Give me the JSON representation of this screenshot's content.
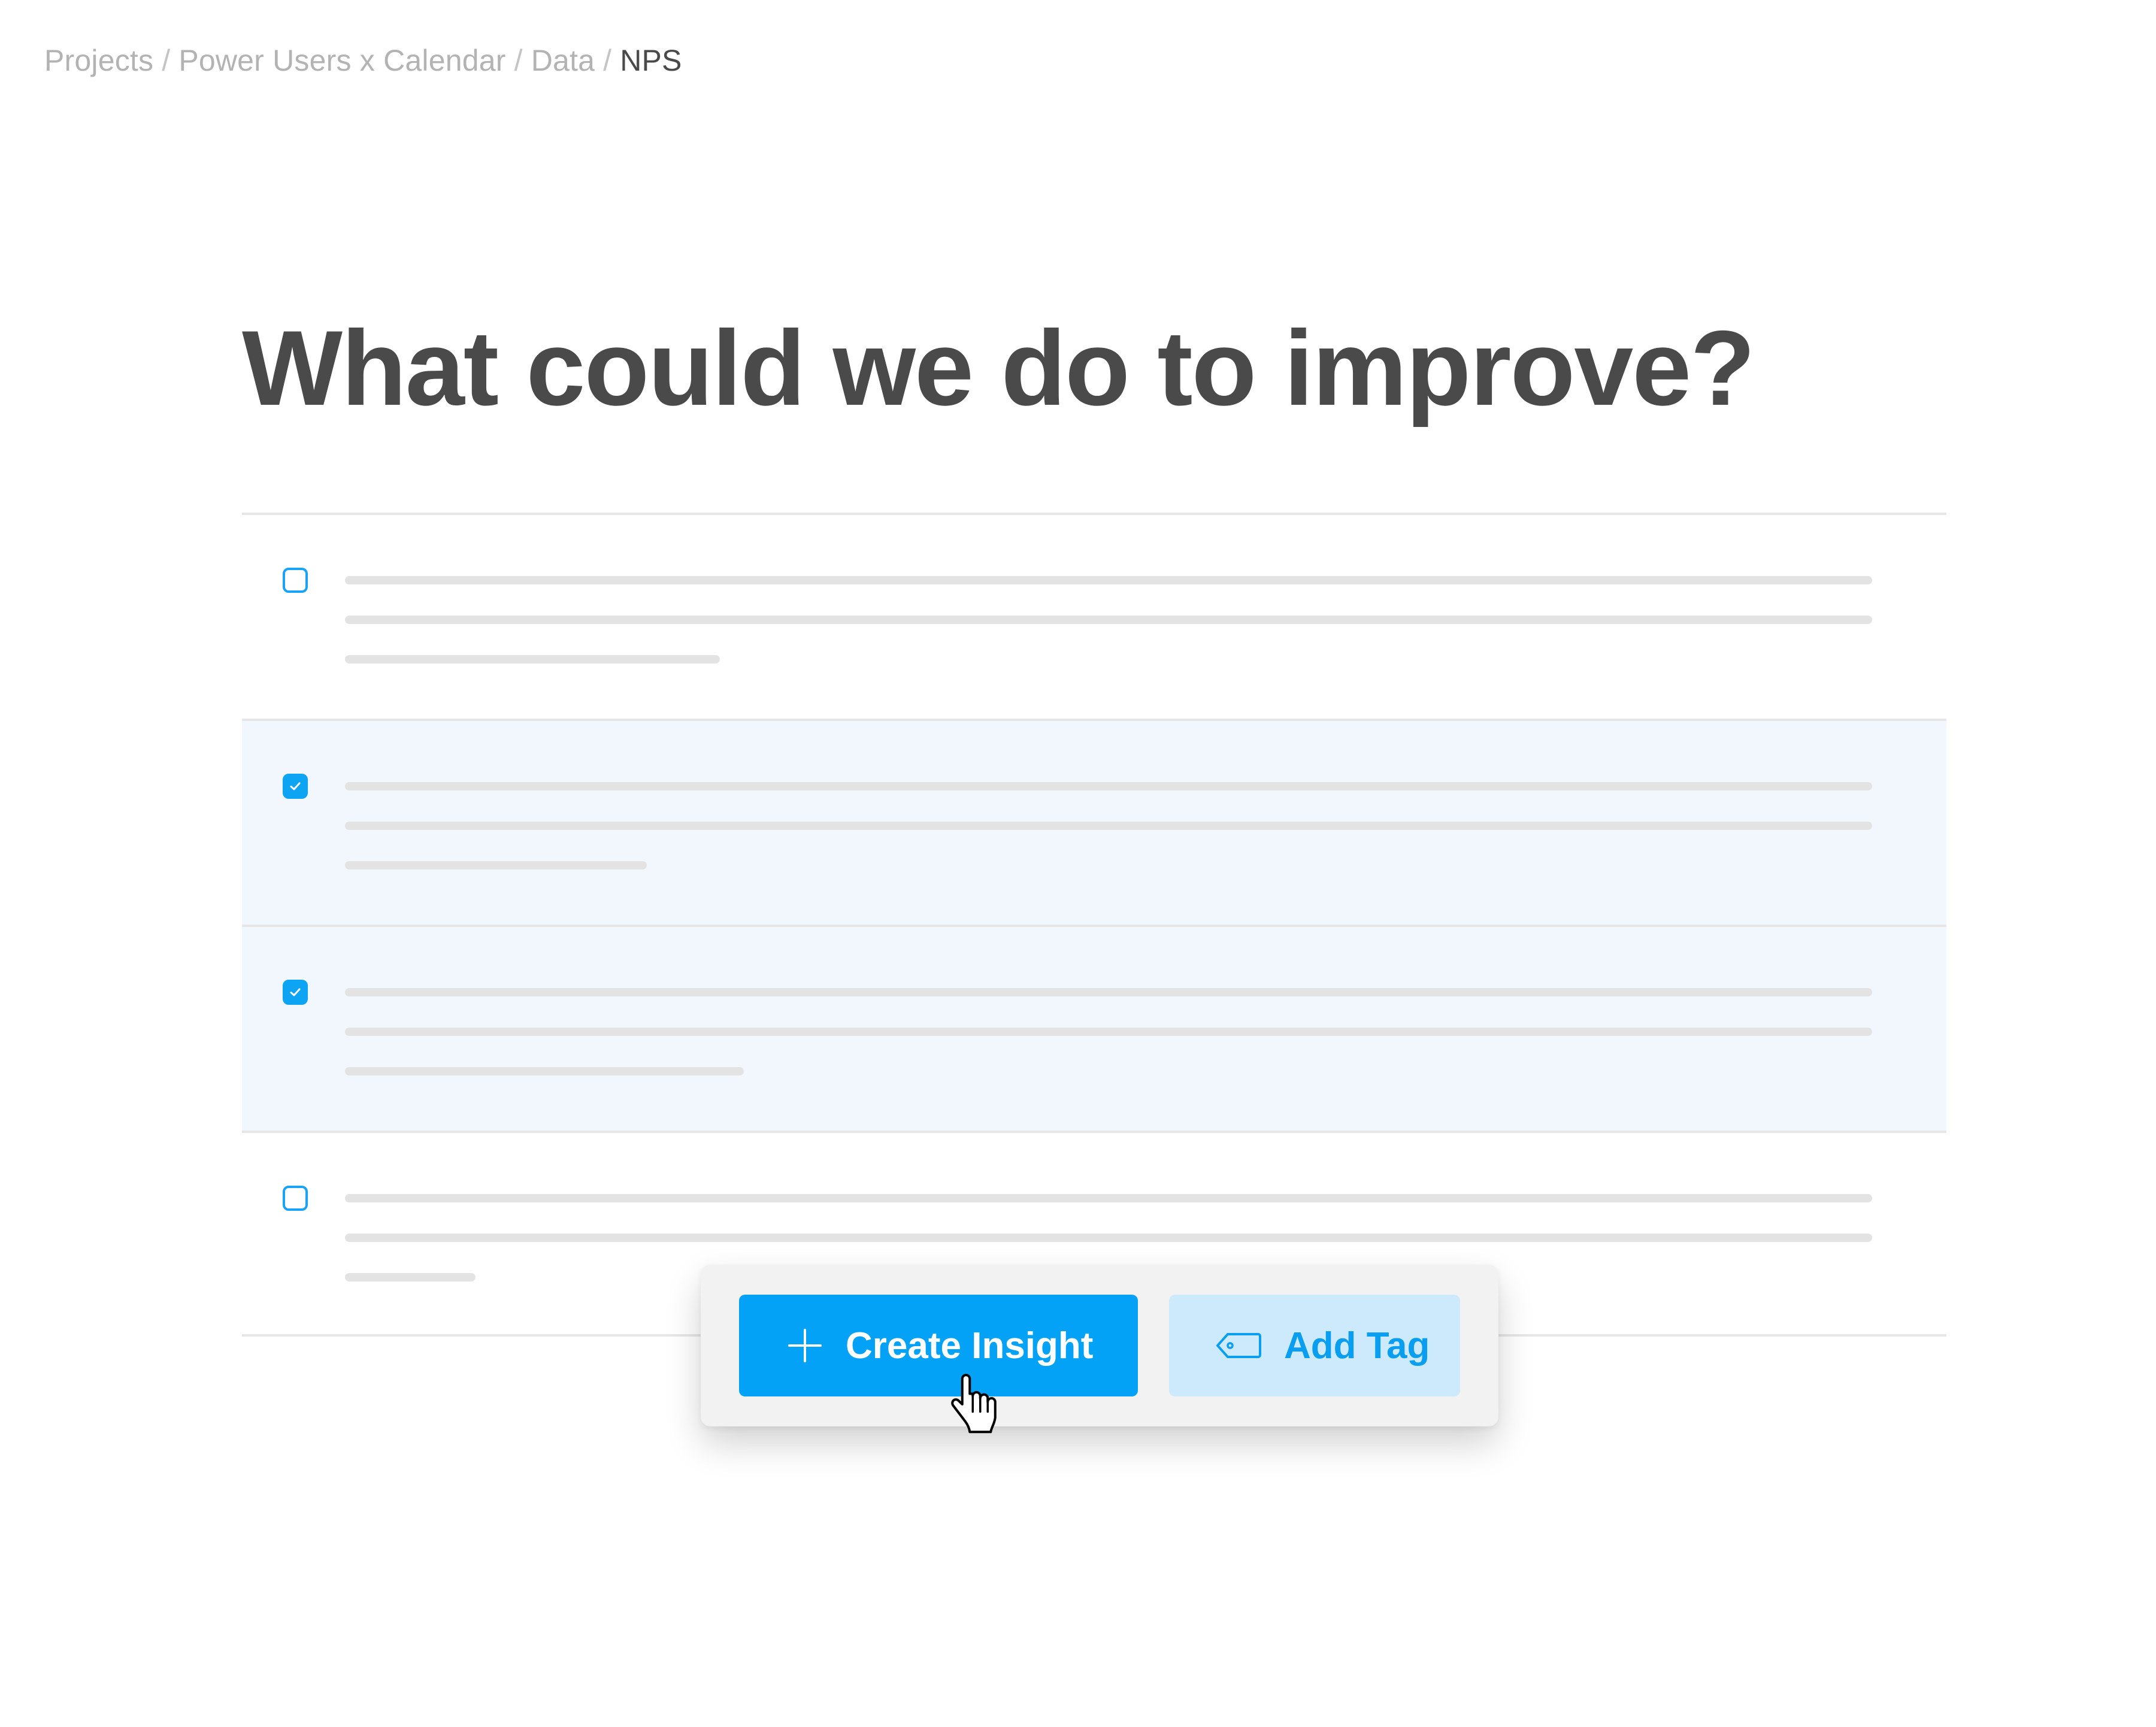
{
  "breadcrumb": {
    "items": [
      "Projects",
      "Power Users x Calendar",
      "Data"
    ],
    "separator": "/",
    "current": "NPS"
  },
  "page": {
    "title": "What could we do to improve?"
  },
  "responses": [
    {
      "selected": false
    },
    {
      "selected": true
    },
    {
      "selected": true
    },
    {
      "selected": false
    }
  ],
  "actions": {
    "create_insight_label": "Create Insight",
    "create_insight_icon": "plus-icon",
    "add_tag_label": "Add Tag",
    "add_tag_icon": "tag-icon"
  },
  "colors": {
    "accent": "#03a2f7",
    "selected_row": "#f1f7fd",
    "secondary_button": "#cceafb"
  }
}
